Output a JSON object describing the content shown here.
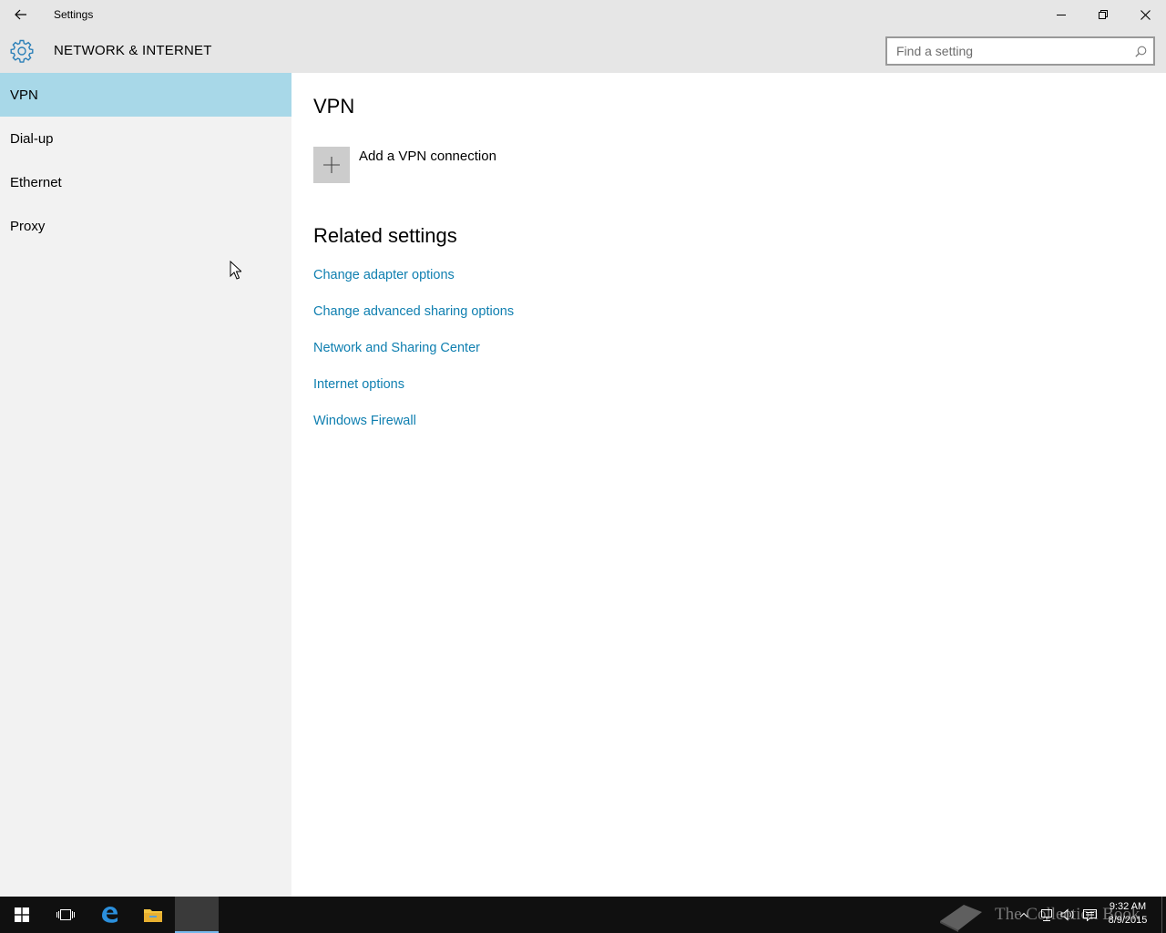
{
  "window": {
    "title": "Settings"
  },
  "header": {
    "title": "NETWORK & INTERNET",
    "search_placeholder": "Find a setting"
  },
  "sidebar": {
    "items": [
      {
        "label": "VPN",
        "active": true
      },
      {
        "label": "Dial-up",
        "active": false
      },
      {
        "label": "Ethernet",
        "active": false
      },
      {
        "label": "Proxy",
        "active": false
      }
    ]
  },
  "main": {
    "title": "VPN",
    "add_vpn_label": "Add a VPN connection",
    "related_title": "Related settings",
    "links": [
      "Change adapter options",
      "Change advanced sharing options",
      "Network and Sharing Center",
      "Internet options",
      "Windows Firewall"
    ]
  },
  "taskbar": {
    "watermark": "The Collection Book",
    "time": "9:32 AM",
    "date": "8/9/2015"
  },
  "colors": {
    "accent_link": "#0f7fb0",
    "active_nav": "#a8d8e8",
    "gear": "#2a7fb8"
  }
}
